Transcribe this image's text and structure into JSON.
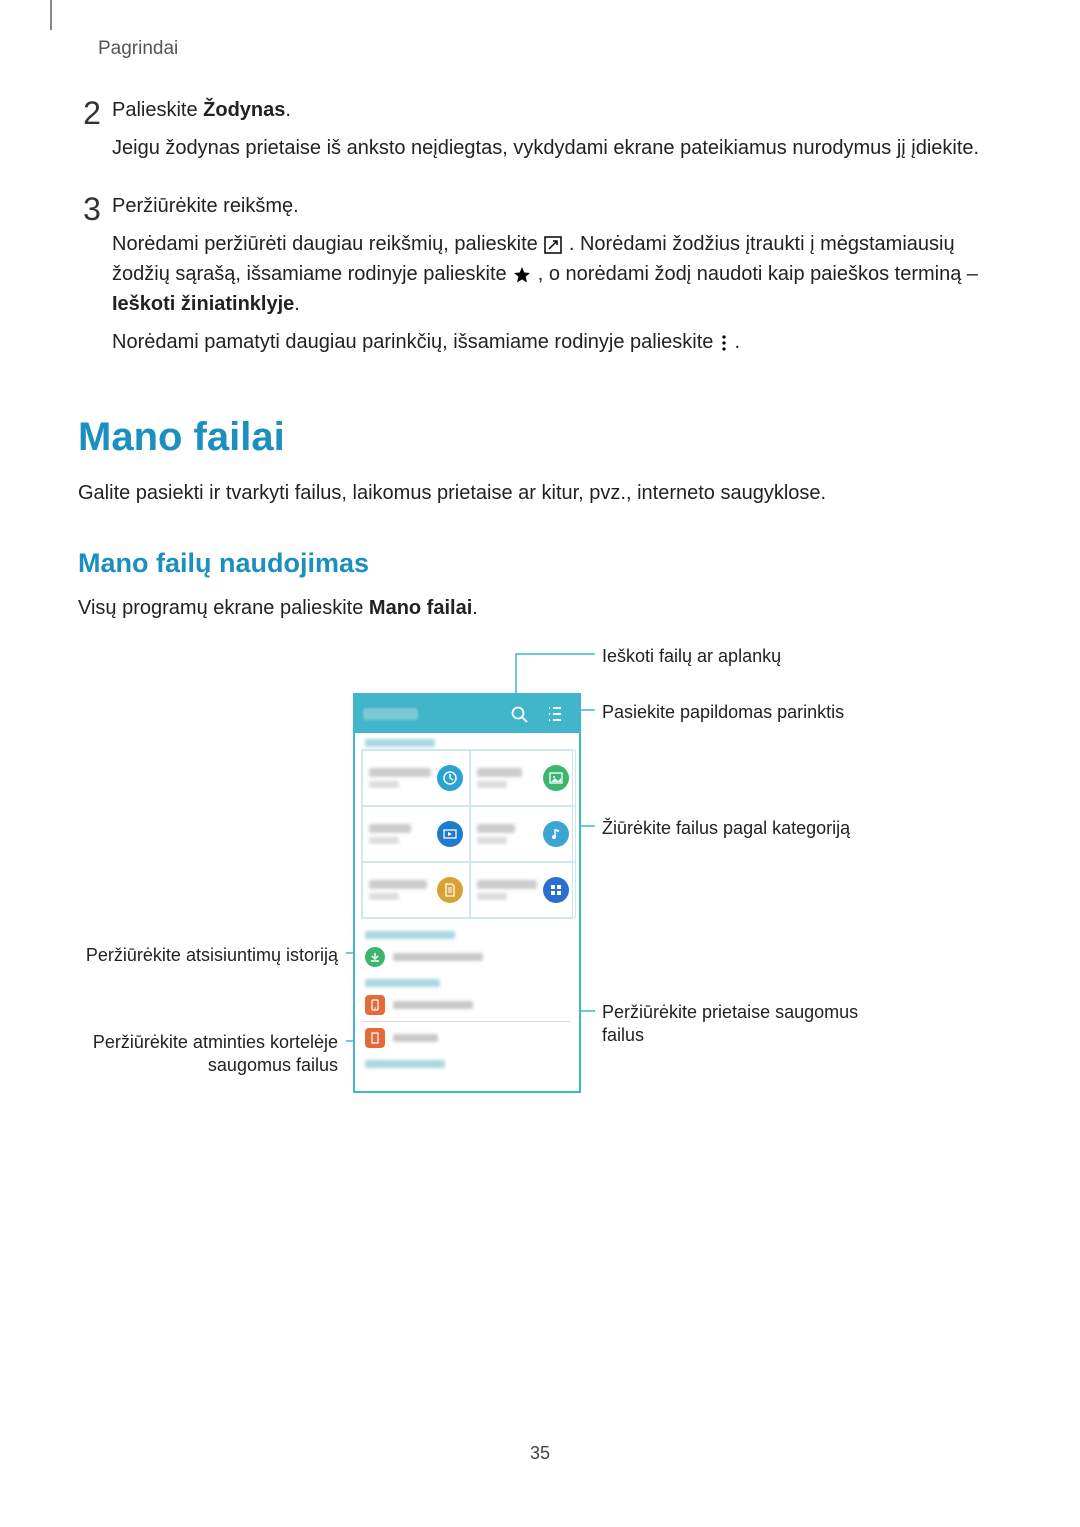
{
  "header": "Pagrindai",
  "steps": {
    "s2": {
      "num": "2",
      "line1_a": "Palieskite ",
      "line1_b": "Žodynas",
      "line1_c": ".",
      "line2": "Jeigu žodynas prietaise iš anksto neįdiegtas, vykdydami ekrane pateikiamus nurodymus jį įdiekite."
    },
    "s3": {
      "num": "3",
      "line1": "Peržiūrėkite reikšmę.",
      "p1_a": "Norėdami peržiūrėti daugiau reikšmių, palieskite ",
      "p1_b": ". Norėdami žodžius įtraukti į mėgstamiausių žodžių sąrašą, išsamiame rodinyje palieskite ",
      "p1_c": ", o norėdami žodį naudoti kaip paieškos terminą – ",
      "p1_d": "Ieškoti žiniatinklyje",
      "p1_e": ".",
      "p2_a": "Norėdami pamatyti daugiau parinkčių, išsamiame rodinyje palieskite ",
      "p2_b": "."
    }
  },
  "h1": "Mano failai",
  "intro": "Galite pasiekti ir tvarkyti failus, laikomus prietaise ar kitur, pvz., interneto saugyklose.",
  "h2": "Mano failų naudojimas",
  "body2_a": "Visų programų ekrane palieskite ",
  "body2_b": "Mano failai",
  "body2_c": ".",
  "callouts": {
    "search": "Ieškoti failų ar aplankų",
    "options": "Pasiekite papildomas parinktis",
    "category": "Žiūrėkite failus pagal kategoriją",
    "downloads": "Peržiūrėkite atsisiuntimų istoriją",
    "device": "Peržiūrėkite prietaise saugomus failus",
    "sdcard": "Peržiūrėkite atminties kortelėje saugomus failus"
  },
  "page_num": "35"
}
